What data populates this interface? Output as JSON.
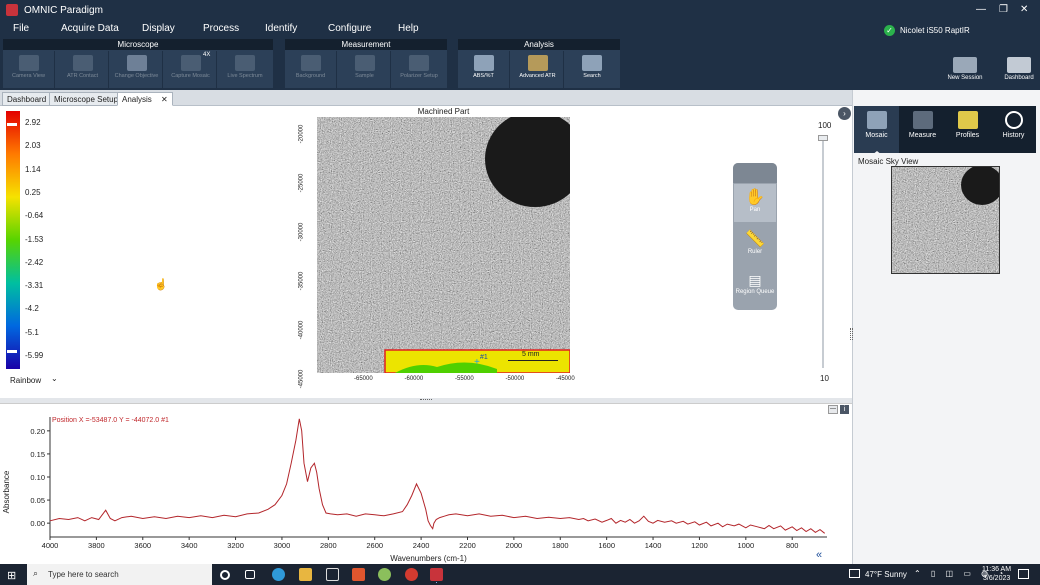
{
  "app": {
    "title": "OMNIC Paradigm",
    "window_controls": {
      "minimize": "—",
      "restore": "❐",
      "close": "✕"
    }
  },
  "menu": [
    "File",
    "Acquire Data",
    "Display",
    "Process",
    "Identify",
    "Configure",
    "Help"
  ],
  "instrument": {
    "name": "Nicolet iS50 RaptIR",
    "status_color": "#2bb24c"
  },
  "ribbon": {
    "groups": [
      {
        "title": "Microscope",
        "buttons": [
          {
            "label": "Camera View",
            "enabled": false
          },
          {
            "label": "ATR Contact",
            "enabled": false
          },
          {
            "label": "Change Objective",
            "enabled": false
          },
          {
            "label": "Capture Mosaic",
            "enabled": false,
            "badge": "4X"
          },
          {
            "label": "Live Spectrum",
            "enabled": false
          }
        ]
      },
      {
        "title": "Measurement",
        "buttons": [
          {
            "label": "Background",
            "enabled": false
          },
          {
            "label": "Sample",
            "enabled": false
          },
          {
            "label": "Polarizer Setup",
            "enabled": false
          }
        ]
      },
      {
        "title": "Analysis",
        "buttons": [
          {
            "label": "ABS/%T",
            "enabled": true
          },
          {
            "label": "Advanced ATR",
            "enabled": true
          },
          {
            "label": "Search",
            "enabled": true
          }
        ]
      }
    ],
    "right_buttons": [
      {
        "label": "New Session"
      },
      {
        "label": "Dashboard"
      }
    ]
  },
  "tabs": [
    {
      "label": "Dashboard",
      "active": false
    },
    {
      "label": "Microscope Setup",
      "active": false
    },
    {
      "label": "Analysis",
      "active": true,
      "close": "✕"
    }
  ],
  "colorbar": {
    "ticks": [
      "2.92",
      "2.03",
      "1.14",
      "0.25",
      "-0.64",
      "-1.53",
      "-2.42",
      "-3.31",
      "-4.2",
      "-5.1",
      "-5.99"
    ],
    "colormap": "Rainbow"
  },
  "mosaic": {
    "title": "Machined Part",
    "scale_bar": "5 mm",
    "marker": "#1",
    "y_ticks": [
      "-20000",
      "-25000",
      "-30000",
      "-35000",
      "-40000",
      "-45000"
    ],
    "x_ticks": [
      "-65000",
      "-60000",
      "-55000",
      "-50000",
      "-45000"
    ]
  },
  "tools": [
    "Pan",
    "Ruler",
    "Region Queue"
  ],
  "zoom_slider": {
    "max_label": "100",
    "min_label": "10",
    "value_fraction": 1.0
  },
  "right_tools": [
    {
      "label": "Mosaic",
      "active": true
    },
    {
      "label": "Measure",
      "active": false
    },
    {
      "label": "Profiles",
      "active": false
    },
    {
      "label": "History",
      "active": false
    }
  ],
  "skyview": {
    "title": "Mosaic Sky View"
  },
  "spectrum_panel": {
    "buttons": [
      "—",
      "i"
    ],
    "collapse": "«"
  },
  "chart_data": {
    "type": "line",
    "annotation": "Position X =-53487.0 Y = -44072.0 #1",
    "xlabel": "Wavenumbers (cm-1)",
    "ylabel": "Absorbance",
    "xlim": [
      4000,
      650
    ],
    "ylim": [
      -0.03,
      0.23
    ],
    "x_ticks": [
      "4000",
      "3800",
      "3600",
      "3400",
      "3200",
      "3000",
      "2800",
      "2600",
      "2400",
      "2200",
      "2000",
      "1800",
      "1600",
      "1400",
      "1200",
      "1000",
      "800"
    ],
    "y_ticks": [
      "0.20",
      "0.15",
      "0.10",
      "0.05",
      "0.00"
    ],
    "line_color": "#b3262b",
    "grid": false,
    "series": [
      {
        "x": [
          4000,
          3960,
          3920,
          3880,
          3850,
          3820,
          3790,
          3760,
          3740,
          3720,
          3690,
          3650,
          3600,
          3550,
          3500,
          3450,
          3400,
          3350,
          3300,
          3250,
          3200,
          3150,
          3100,
          3060,
          3030,
          3000,
          2980,
          2960,
          2940,
          2925,
          2915,
          2905,
          2890,
          2875,
          2860,
          2850,
          2840,
          2825,
          2810,
          2790,
          2760,
          2720,
          2680,
          2640,
          2600,
          2560,
          2520,
          2480,
          2460,
          2440,
          2420,
          2400,
          2380,
          2370,
          2360,
          2350,
          2345,
          2335,
          2320,
          2300,
          2280,
          2250,
          2200,
          2150,
          2100,
          2050,
          2000,
          1950,
          1900,
          1850,
          1800,
          1760,
          1720,
          1700,
          1680,
          1650,
          1620,
          1600,
          1580,
          1560,
          1540,
          1520,
          1500,
          1480,
          1460,
          1440,
          1420,
          1400,
          1380,
          1350,
          1320,
          1300,
          1270,
          1250,
          1220,
          1200,
          1170,
          1150,
          1120,
          1100,
          1080,
          1050,
          1030,
          1000,
          980,
          950,
          920,
          900,
          880,
          850,
          830,
          800,
          780,
          760,
          740,
          720,
          700,
          680,
          660
        ],
        "y": [
          0.005,
          0.01,
          0.008,
          0.012,
          0.005,
          0.012,
          0.008,
          0.028,
          0.01,
          0.005,
          0.012,
          0.015,
          0.01,
          0.014,
          0.01,
          0.015,
          0.012,
          0.016,
          0.012,
          0.017,
          0.014,
          0.02,
          0.022,
          0.03,
          0.04,
          0.06,
          0.085,
          0.13,
          0.18,
          0.226,
          0.2,
          0.13,
          0.09,
          0.12,
          0.13,
          0.11,
          0.075,
          0.04,
          0.022,
          0.02,
          0.018,
          0.02,
          0.015,
          0.02,
          0.018,
          0.016,
          0.02,
          0.025,
          0.04,
          0.06,
          0.085,
          0.065,
          0.03,
          0.005,
          -0.005,
          -0.012,
          0.0,
          0.008,
          0.012,
          0.015,
          0.018,
          0.02,
          0.016,
          0.02,
          0.015,
          0.017,
          0.012,
          0.015,
          0.01,
          0.013,
          0.01,
          0.012,
          0.008,
          0.01,
          0.005,
          0.009,
          0.002,
          0.006,
          0.01,
          0.0,
          0.006,
          0.002,
          0.008,
          0.0,
          0.005,
          0.015,
          0.004,
          0.0,
          0.006,
          0.002,
          0.005,
          0.0,
          0.004,
          -0.002,
          0.003,
          -0.004,
          0.002,
          -0.006,
          0.0,
          -0.008,
          -0.002,
          -0.006,
          -0.002,
          -0.01,
          -0.004,
          -0.008,
          -0.012,
          -0.005,
          -0.012,
          -0.006,
          -0.015,
          -0.008,
          -0.016,
          -0.01,
          -0.018,
          -0.012,
          -0.02,
          -0.014,
          -0.022
        ]
      }
    ]
  },
  "taskbar": {
    "search_placeholder": "Type here to search",
    "weather": "47°F  Sunny",
    "time": "11:36 AM",
    "date": "3/6/2023"
  }
}
